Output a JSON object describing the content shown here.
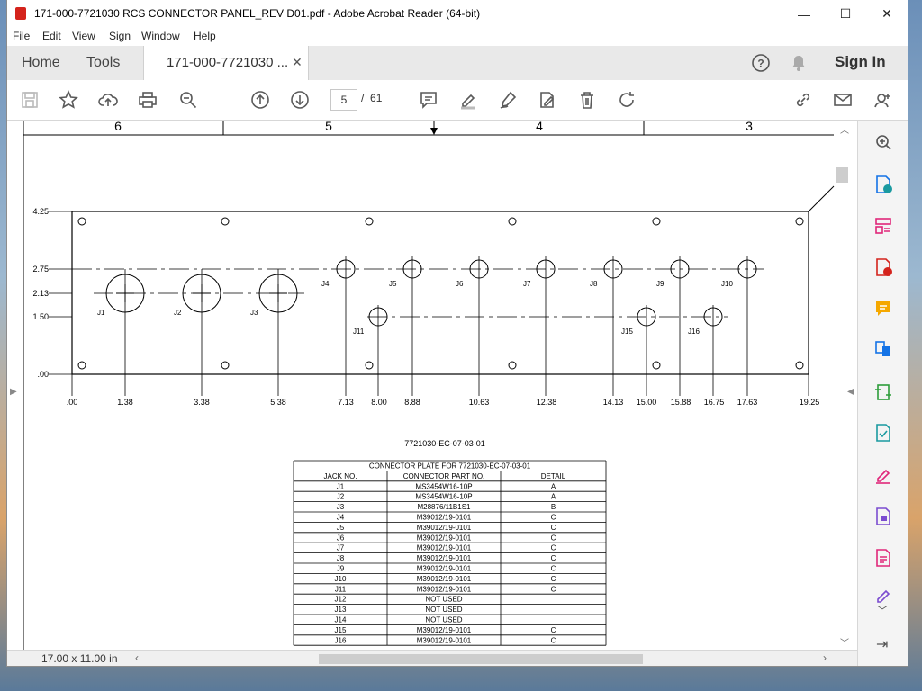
{
  "window": {
    "title": "171-000-7721030 RCS CONNECTOR PANEL_REV D01.pdf - Adobe Acrobat Reader (64-bit)",
    "minimize": "—",
    "maximize": "☐",
    "close": "✕"
  },
  "menu": [
    "File",
    "Edit",
    "View",
    "Sign",
    "Window",
    "Help"
  ],
  "tabs": {
    "home": "Home",
    "tools": "Tools",
    "document": "171-000-7721030 ...",
    "sign_in": "Sign In"
  },
  "toolbar": {
    "page_current": "5",
    "page_separator": "/",
    "page_total": "61"
  },
  "drawing": {
    "zones": [
      "6",
      "5",
      "4",
      "3"
    ],
    "y_dims": [
      "4.25",
      "2.75",
      "2.13",
      "1.50",
      ".00"
    ],
    "x_dims": [
      ".00",
      "1.38",
      "3.38",
      "5.38",
      "7.13",
      "8.00",
      "8.88",
      "10.63",
      "12.38",
      "14.13",
      "15.00",
      "15.88",
      "16.75",
      "17.63",
      "19.25"
    ],
    "jacks": [
      "J1",
      "J2",
      "J3",
      "J4",
      "J5",
      "J6",
      "J7",
      "J8",
      "J9",
      "J10",
      "J11",
      "J15",
      "J16"
    ],
    "drawing_number": "7721030-EC-07-03-01"
  },
  "table": {
    "title": "CONNECTOR PLATE FOR 7721030-EC-07-03-01",
    "headers": [
      "JACK NO.",
      "CONNECTOR PART NO.",
      "DETAIL"
    ],
    "rows": [
      [
        "J1",
        "MS3454W16-10P",
        "A"
      ],
      [
        "J2",
        "MS3454W16-10P",
        "A"
      ],
      [
        "J3",
        "M28876/11B1S1",
        "B"
      ],
      [
        "J4",
        "M39012/19-0101",
        "C"
      ],
      [
        "J5",
        "M39012/19-0101",
        "C"
      ],
      [
        "J6",
        "M39012/19-0101",
        "C"
      ],
      [
        "J7",
        "M39012/19-0101",
        "C"
      ],
      [
        "J8",
        "M39012/19-0101",
        "C"
      ],
      [
        "J9",
        "M39012/19-0101",
        "C"
      ],
      [
        "J10",
        "M39012/19-0101",
        "C"
      ],
      [
        "J11",
        "M39012/19-0101",
        "C"
      ],
      [
        "J12",
        "NOT USED",
        ""
      ],
      [
        "J13",
        "NOT USED",
        ""
      ],
      [
        "J14",
        "NOT USED",
        ""
      ],
      [
        "J15",
        "M39012/19-0101",
        "C"
      ],
      [
        "J16",
        "M39012/19-0101",
        "C"
      ]
    ]
  },
  "status": {
    "page_size": "17.00 x 11.00 in"
  },
  "colors": {
    "accent_red": "#d4231c",
    "tool_blue": "#1473e6",
    "tool_pink": "#e0277a",
    "tool_yellow": "#f5a800",
    "tool_purple": "#7b4cd0",
    "tool_teal": "#1a9aa0",
    "tool_green": "#2d9d3a"
  }
}
